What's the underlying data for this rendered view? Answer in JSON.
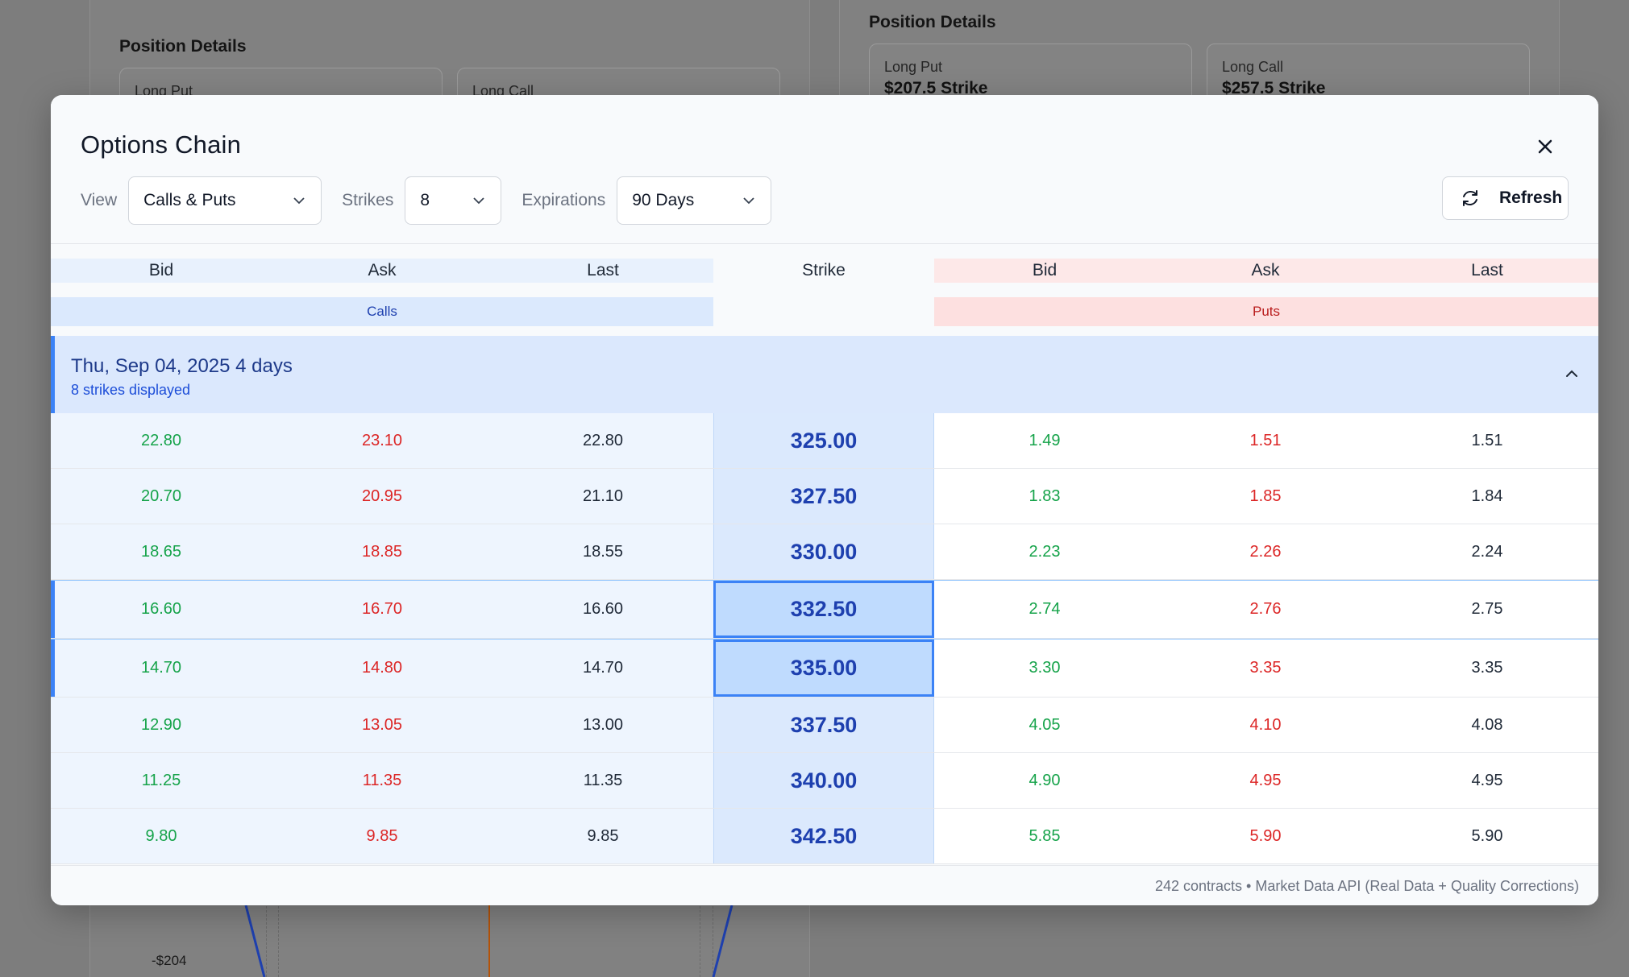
{
  "background": {
    "left_title": "Position Details",
    "right_title": "Position Details",
    "left_positions": [
      {
        "kind": "Long Put"
      },
      {
        "kind": "Long Call"
      }
    ],
    "right_positions": [
      {
        "kind": "Long Put",
        "strike": "$207.5 Strike"
      },
      {
        "kind": "Long Call",
        "strike": "$257.5 Strike"
      }
    ],
    "axis_label": "-$204"
  },
  "modal": {
    "title": "Options Chain",
    "close_icon": "close-icon",
    "controls": {
      "view_label": "View",
      "view_value": "Calls & Puts",
      "strikes_label": "Strikes",
      "strikes_value": "8",
      "expirations_label": "Expirations",
      "expirations_value": "90 Days",
      "refresh_label": "Refresh"
    },
    "columns": {
      "calls": [
        "Bid",
        "Ask",
        "Last"
      ],
      "strike": "Strike",
      "puts": [
        "Bid",
        "Ask",
        "Last"
      ]
    },
    "groups": {
      "calls": "Calls",
      "puts": "Puts"
    },
    "expiration": {
      "title": "Thu, Sep 04, 2025 4 days",
      "subtitle": "8 strikes displayed"
    },
    "rows": [
      {
        "call_bid": "22.80",
        "call_ask": "23.10",
        "call_last": "22.80",
        "strike": "325.00",
        "put_bid": "1.49",
        "put_ask": "1.51",
        "put_last": "1.51",
        "highlight": false
      },
      {
        "call_bid": "20.70",
        "call_ask": "20.95",
        "call_last": "21.10",
        "strike": "327.50",
        "put_bid": "1.83",
        "put_ask": "1.85",
        "put_last": "1.84",
        "highlight": false
      },
      {
        "call_bid": "18.65",
        "call_ask": "18.85",
        "call_last": "18.55",
        "strike": "330.00",
        "put_bid": "2.23",
        "put_ask": "2.26",
        "put_last": "2.24",
        "highlight": false
      },
      {
        "call_bid": "16.60",
        "call_ask": "16.70",
        "call_last": "16.60",
        "strike": "332.50",
        "put_bid": "2.74",
        "put_ask": "2.76",
        "put_last": "2.75",
        "highlight": true
      },
      {
        "call_bid": "14.70",
        "call_ask": "14.80",
        "call_last": "14.70",
        "strike": "335.00",
        "put_bid": "3.30",
        "put_ask": "3.35",
        "put_last": "3.35",
        "highlight": true
      },
      {
        "call_bid": "12.90",
        "call_ask": "13.05",
        "call_last": "13.00",
        "strike": "337.50",
        "put_bid": "4.05",
        "put_ask": "4.10",
        "put_last": "4.08",
        "highlight": false
      },
      {
        "call_bid": "11.25",
        "call_ask": "11.35",
        "call_last": "11.35",
        "strike": "340.00",
        "put_bid": "4.90",
        "put_ask": "4.95",
        "put_last": "4.95",
        "highlight": false
      },
      {
        "call_bid": "9.80",
        "call_ask": "9.85",
        "call_last": "9.85",
        "strike": "342.50",
        "put_bid": "5.85",
        "put_ask": "5.90",
        "put_last": "5.90",
        "highlight": false
      }
    ],
    "footer": "242 contracts • Market Data API (Real Data + Quality Corrections)"
  },
  "colors": {
    "bid": "#16a34a",
    "ask": "#dc2626",
    "accent": "#3b82f6",
    "strike_text": "#1e40af"
  }
}
